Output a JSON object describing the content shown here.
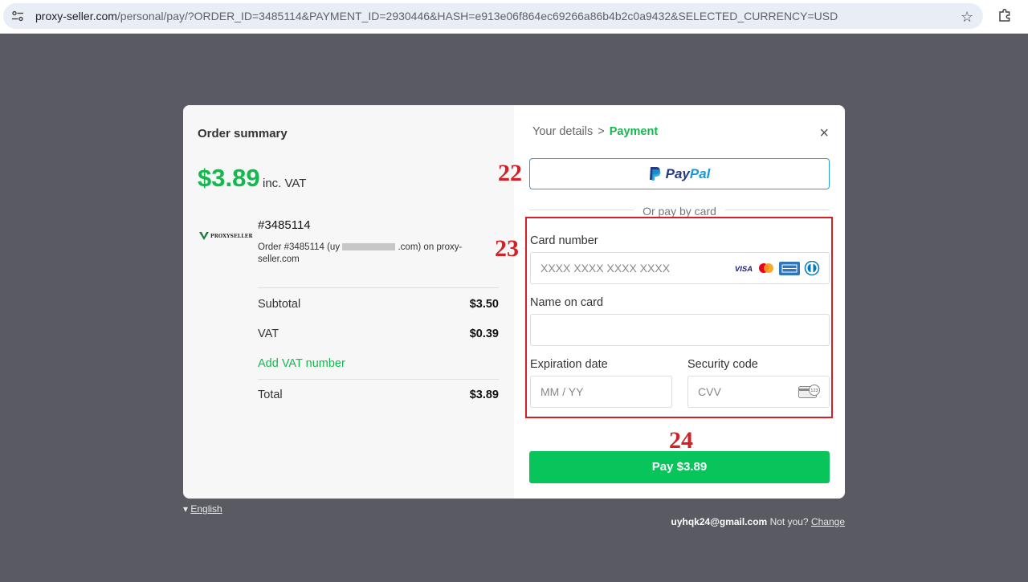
{
  "browser": {
    "url_host": "proxy-seller.com",
    "url_path": "/personal/pay/?ORDER_ID=3485114&PAYMENT_ID=2930446&HASH=e913e06f864ec69266a86b4b2c0a9432&SELECTED_CURRENCY=USD"
  },
  "summary": {
    "title": "Order summary",
    "price": "$3.89",
    "vat_note": "inc. VAT",
    "logo_text": "PROXYSELLER",
    "order_id": "#3485114",
    "order_desc_prefix": "Order #3485114 (uy",
    "order_desc_suffix": ".com) on proxy-seller.com",
    "rows": [
      {
        "label": "Subtotal",
        "value": "$3.50"
      },
      {
        "label": "VAT",
        "value": "$0.39"
      },
      {
        "label": "Total",
        "value": "$3.89"
      }
    ],
    "add_vat": "Add VAT number"
  },
  "payment": {
    "step1": "Your details",
    "separator": ">",
    "step2": "Payment",
    "close": "×",
    "paypal_pay": "Pay",
    "paypal_pal": "Pal",
    "or_text": "Or pay by card",
    "card_number_label": "Card number",
    "card_number_placeholder": "XXXX XXXX XXXX XXXX",
    "name_label": "Name on card",
    "name_placeholder": "",
    "exp_label": "Expiration date",
    "exp_placeholder": "MM / YY",
    "cvv_label": "Security code",
    "cvv_placeholder": "CVV",
    "cvv_icon_text": "123",
    "card_brands": [
      "VISA",
      "mastercard",
      "amex",
      "diners"
    ],
    "pay_button": "Pay $3.89"
  },
  "annotations": [
    "22",
    "23",
    "24"
  ],
  "footer": {
    "language": "English",
    "email": "uyhqk24@gmail.com",
    "not_you": "Not you?",
    "change": "Change"
  },
  "colors": {
    "accent_green": "#14b94e",
    "pay_button": "#07c45b",
    "annotation_red": "#d32027",
    "backdrop": "#5a5a62"
  }
}
